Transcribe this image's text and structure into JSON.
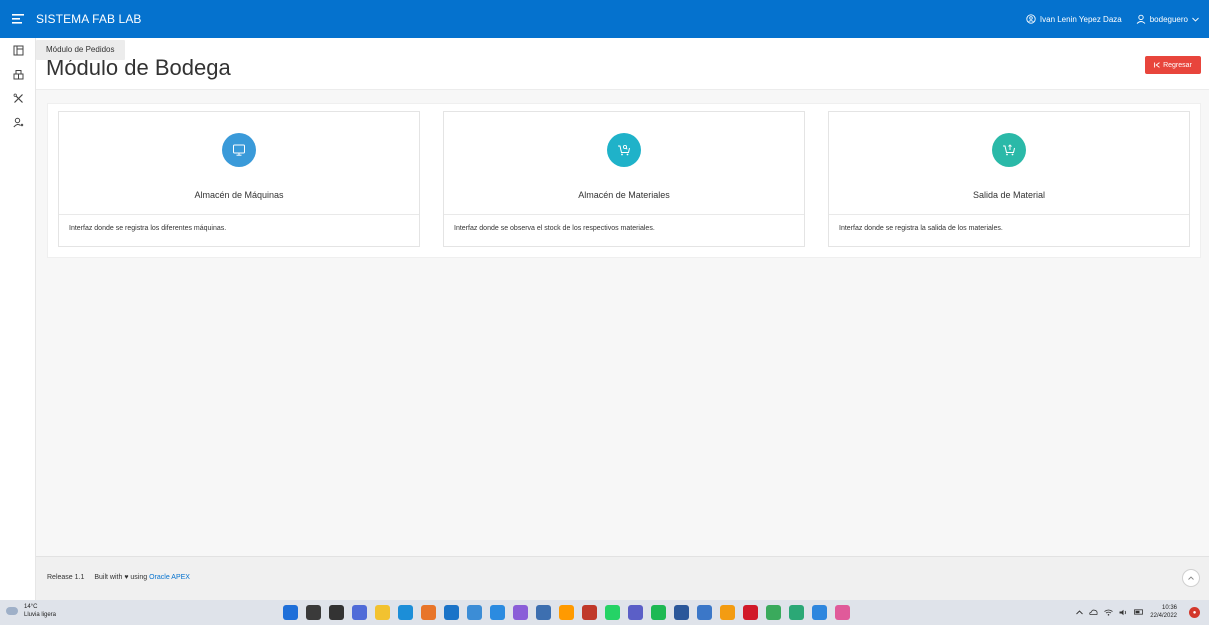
{
  "header": {
    "app_title": "SISTEMA FAB LAB",
    "user_full_name": "Ivan Lenin Yepez Daza",
    "username": "bodeguero"
  },
  "sidebar": {
    "tooltip": "Módulo de Pedidos",
    "items": [
      {
        "icon": "orders-icon"
      },
      {
        "icon": "warehouse-icon"
      },
      {
        "icon": "tools-icon"
      },
      {
        "icon": "user-settings-icon"
      }
    ]
  },
  "page": {
    "title": "Módulo de Bodega",
    "back_label": "Regresar"
  },
  "cards": [
    {
      "title": "Almacén de Máquinas",
      "description": "Interfaz donde se registra los diferentes máquinas.",
      "color": "#3a9ad9",
      "icon": "monitor-icon"
    },
    {
      "title": "Almacén de Materiales",
      "description": "Interfaz donde se observa el stock de los respectivos materiales.",
      "color": "#1fb2c9",
      "icon": "cart-search-icon"
    },
    {
      "title": "Salida de Material",
      "description": "Interfaz donde se registra la salida de los materiales.",
      "color": "#2ab9a8",
      "icon": "cart-upload-icon"
    }
  ],
  "footer": {
    "release": "Release 1.1",
    "built_with": "Built with ♥ using",
    "oracle_link": "Oracle APEX"
  },
  "taskbar": {
    "temperature": "14°C",
    "weather": "Lluvia ligera",
    "time": "10:36",
    "date": "22/4/2022",
    "apps": [
      {
        "name": "windows-start-icon",
        "color": "#1e6fd9"
      },
      {
        "name": "search-icon",
        "color": "#3a3a3a"
      },
      {
        "name": "task-view-icon",
        "color": "#333333"
      },
      {
        "name": "chat-icon",
        "color": "#4f6bd8"
      },
      {
        "name": "file-explorer-icon",
        "color": "#f2c230"
      },
      {
        "name": "edge-icon",
        "color": "#1c8ed8"
      },
      {
        "name": "firefox-icon",
        "color": "#e8752a"
      },
      {
        "name": "app-l-icon",
        "color": "#1a73c8"
      },
      {
        "name": "photos-icon",
        "color": "#3c8dd6"
      },
      {
        "name": "vscode-icon",
        "color": "#2b8be0"
      },
      {
        "name": "visual-studio-icon",
        "color": "#8a5ed8"
      },
      {
        "name": "virtualbox-icon",
        "color": "#3d6fb0"
      },
      {
        "name": "illustrator-icon",
        "color": "#ff9a00"
      },
      {
        "name": "access-icon",
        "color": "#c0392b"
      },
      {
        "name": "whatsapp-icon",
        "color": "#25d366"
      },
      {
        "name": "teams-icon",
        "color": "#5b5fc7"
      },
      {
        "name": "spotify-icon",
        "color": "#1db954"
      },
      {
        "name": "word-icon",
        "color": "#2b579a"
      },
      {
        "name": "app-blue-icon",
        "color": "#3b77c8"
      },
      {
        "name": "app-orange-icon",
        "color": "#f39c12"
      },
      {
        "name": "opera-icon",
        "color": "#d11a2a"
      },
      {
        "name": "app-green-icon",
        "color": "#3aaa5c"
      },
      {
        "name": "app-teal-icon",
        "color": "#2ba876"
      },
      {
        "name": "gallery-icon",
        "color": "#2e86de"
      },
      {
        "name": "app-pink-icon",
        "color": "#e05a9a"
      }
    ]
  }
}
